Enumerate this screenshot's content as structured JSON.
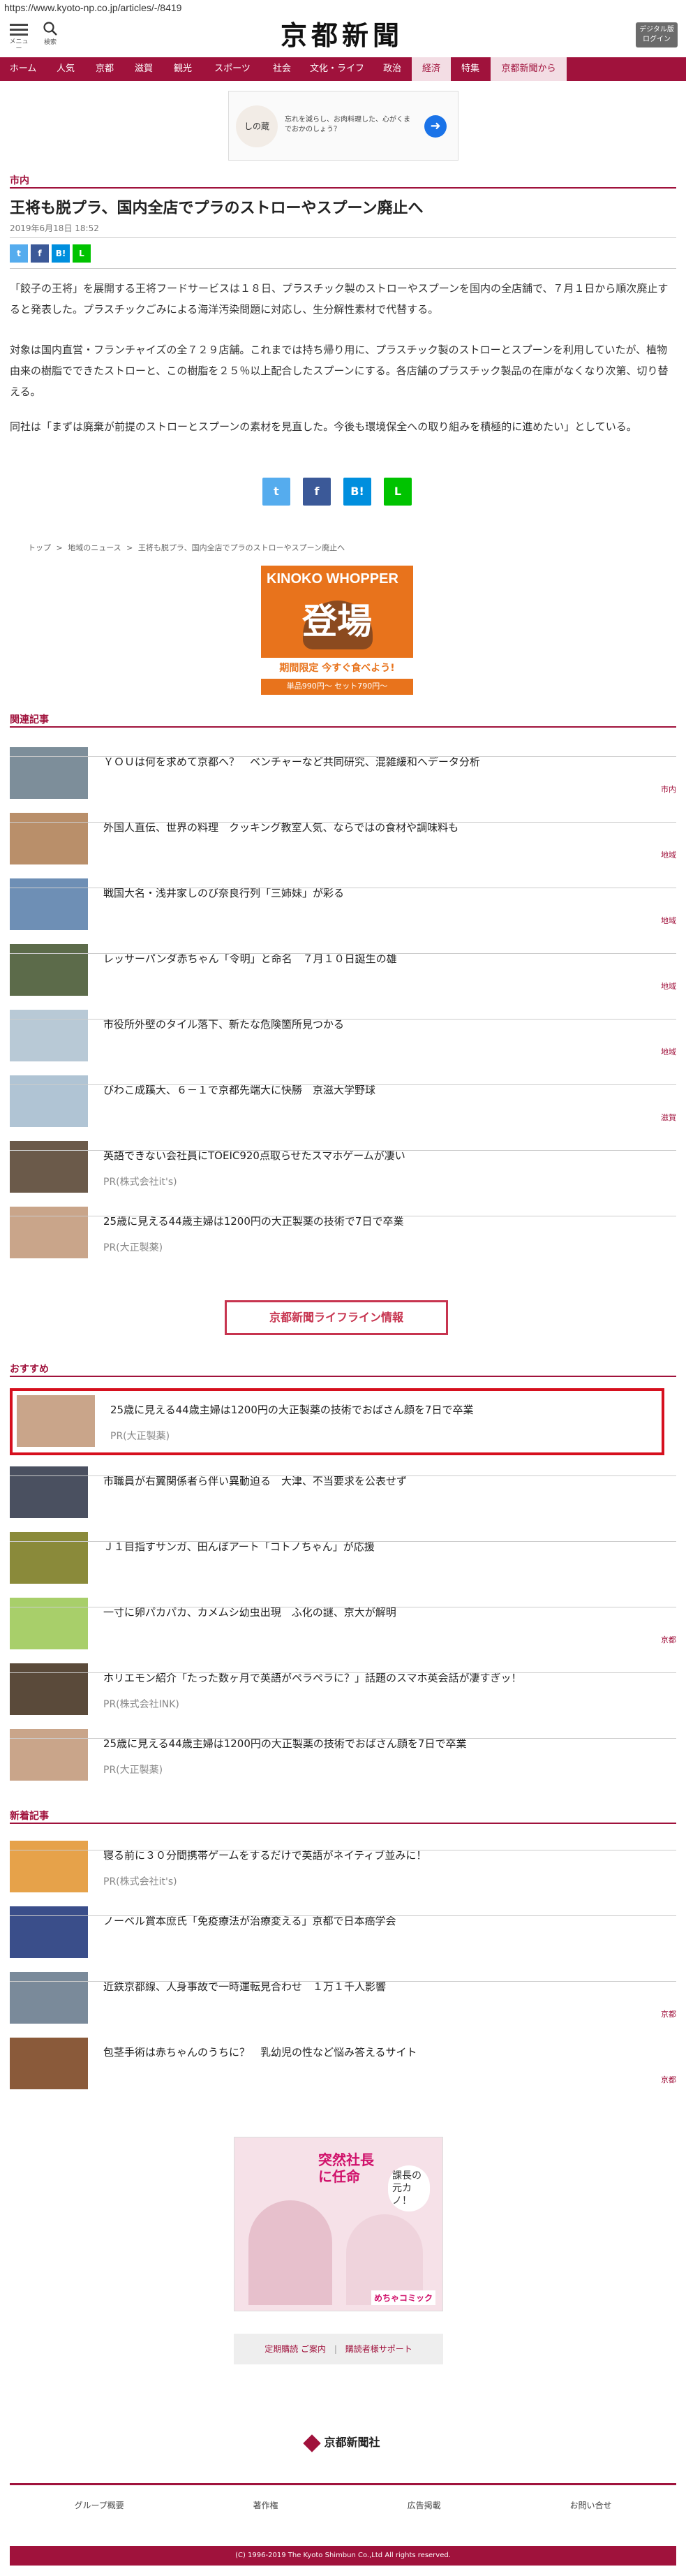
{
  "url": "https://www.kyoto-np.co.jp/articles/-/8419",
  "header": {
    "menu_label": "メニュー",
    "search_label": "検索",
    "logo": "京都新聞",
    "login_line1": "デジタル版",
    "login_line2": "ログイン"
  },
  "nav": {
    "items": [
      "ホーム",
      "人気",
      "京都",
      "滋賀",
      "観光",
      "スポーツ",
      "社会",
      "文化・ライフ",
      "政治",
      "経済",
      "特集",
      "京都新聞から"
    ]
  },
  "ad_top": {
    "brand": "しの蔵",
    "text": "忘れを減らし、お肉料理した、心がくまでおかのしょう？"
  },
  "section": "市内",
  "article": {
    "title": "王将も脱プラ、国内全店でプラのストローやスプーン廃止へ",
    "date": "2019年6月18日 18:52",
    "paragraphs": [
      "「餃子の王将」を展開する王将フードサービスは１８日、プラスチック製のストローやスプーンを国内の全店舗で、７月１日から順次廃止すると発表した。プラスチックごみによる海洋汚染問題に対応し、生分解性素材で代替する。",
      "対象は国内直営・フランチャイズの全７２９店舗。これまでは持ち帰り用に、プラスチック製のストローとスプーンを利用していたが、植物由来の樹脂でできたストローと、この樹脂を２５％以上配合したスプーンにする。各店舗のプラスチック製品の在庫がなくなり次第、切り替える。",
      "同社は「まずは廃棄が前提のストローとスプーンの素材を見直した。今後も環境保全への取り組みを積極的に進めたい」としている。"
    ]
  },
  "share_mini": [
    "t",
    "f",
    "B!",
    "L"
  ],
  "share_big": [
    "t",
    "f",
    "B!",
    "L"
  ],
  "breadcrumb": [
    "トップ",
    ">",
    "地域のニュース",
    ">",
    "王将も脱プラ、国内全店でプラのストローやスプーン廃止へ"
  ],
  "ad_mid": {
    "title": "KINOKO WHOPPER",
    "big_text": "登場",
    "band": "期間限定 今すぐ食べよう!",
    "price": "単品990円〜 セット790円〜"
  },
  "related": {
    "heading": "関連記事",
    "items": [
      {
        "title": "ＹＯＵは何を求めて京都へ？　ベンチャーなど共同研究、混雑緩和へデータ分析",
        "cat": "市内",
        "pr": ""
      },
      {
        "title": "外国人直伝、世界の料理　クッキング教室人気、ならではの食材や調味料も",
        "cat": "地域",
        "pr": ""
      },
      {
        "title": "戦国大名・浅井家しのび奈良行列「三姉妹」が彩る",
        "cat": "地域",
        "pr": ""
      },
      {
        "title": "レッサーパンダ赤ちゃん「令明」と命名　７月１０日誕生の雄",
        "cat": "地域",
        "pr": ""
      },
      {
        "title": "市役所外壁のタイル落下、新たな危険箇所見つかる",
        "cat": "地域",
        "pr": ""
      },
      {
        "title": "びわこ成蹊大、６－１で京都先端大に快勝　京滋大学野球",
        "cat": "滋賀",
        "pr": ""
      },
      {
        "title": "英語できない会社員にTOEIC920点取らせたスマホゲームが凄い",
        "cat": "",
        "pr": "PR(株式会社it's)"
      },
      {
        "title": "25歳に見える44歳主婦は1200円の大正製薬の技術で7日で卒業",
        "cat": "",
        "pr": "PR(大正製薬)"
      }
    ]
  },
  "lifeline_button": "京都新聞ライフライン情報",
  "recommend": {
    "heading": "おすすめ",
    "items": [
      {
        "title": "25歳に見える44歳主婦は1200円の大正製薬の技術でおばさん顔を7日で卒業",
        "cat": "",
        "pr": "PR(大正製薬)"
      },
      {
        "title": "市職員が右翼関係者ら伴い異動迫る　大津、不当要求を公表せず",
        "cat": "",
        "pr": ""
      },
      {
        "title": "Ｊ１目指すサンガ、田んぼアート「コトノちゃん」が応援",
        "cat": "",
        "pr": ""
      },
      {
        "title": "一寸に卵パカパカ、カメムシ幼虫出現　ふ化の謎、京大が解明",
        "cat": "京都",
        "pr": ""
      },
      {
        "title": "ホリエモン紹介「たった数ヶ月で英語がペラペラに？」話題のスマホ英会話が凄すぎッ！",
        "cat": "",
        "pr": "PR(株式会社INK)"
      },
      {
        "title": "25歳に見える44歳主婦は1200円の大正製薬の技術でおばさん顔を7日で卒業",
        "cat": "",
        "pr": "PR(大正製薬)"
      }
    ]
  },
  "latest": {
    "heading": "新着記事",
    "items": [
      {
        "title": "寝る前に３０分間携帯ゲームをするだけで英語がネイティブ並みに！",
        "cat": "",
        "pr": "PR(株式会社it's)"
      },
      {
        "title": "ノーベル賞本庶氏「免疫療法が治療変える」京都で日本癌学会",
        "cat": "",
        "pr": ""
      },
      {
        "title": "近鉄京都線、人身事故で一時運転見合わせ　１万１千人影響",
        "cat": "京都",
        "pr": ""
      },
      {
        "title": "包茎手術は赤ちゃんのうちに？　乳幼児の性など悩み答えるサイト",
        "cat": "京都",
        "pr": ""
      }
    ]
  },
  "bottom_ad": {
    "text1": "突然社長に任命",
    "text2": "課長の元カノ！",
    "brand": "めちゃコミック"
  },
  "footer": {
    "links_box": [
      "定期購読 ご案内",
      "|",
      "購読者様サポート"
    ],
    "logo": "京都新聞社",
    "nav": [
      "グループ概要",
      "著作権",
      "広告掲載",
      "お問い合せ"
    ],
    "copyright": "(C) 1996-2019 The Kyoto Shimbun Co.,Ltd All rights reserved."
  },
  "colors": {
    "brand": "#a0123c",
    "highlight": "#d6101e",
    "twitter": "#55acee",
    "facebook": "#3b5998",
    "hatena": "#008fde",
    "line": "#00c300"
  }
}
